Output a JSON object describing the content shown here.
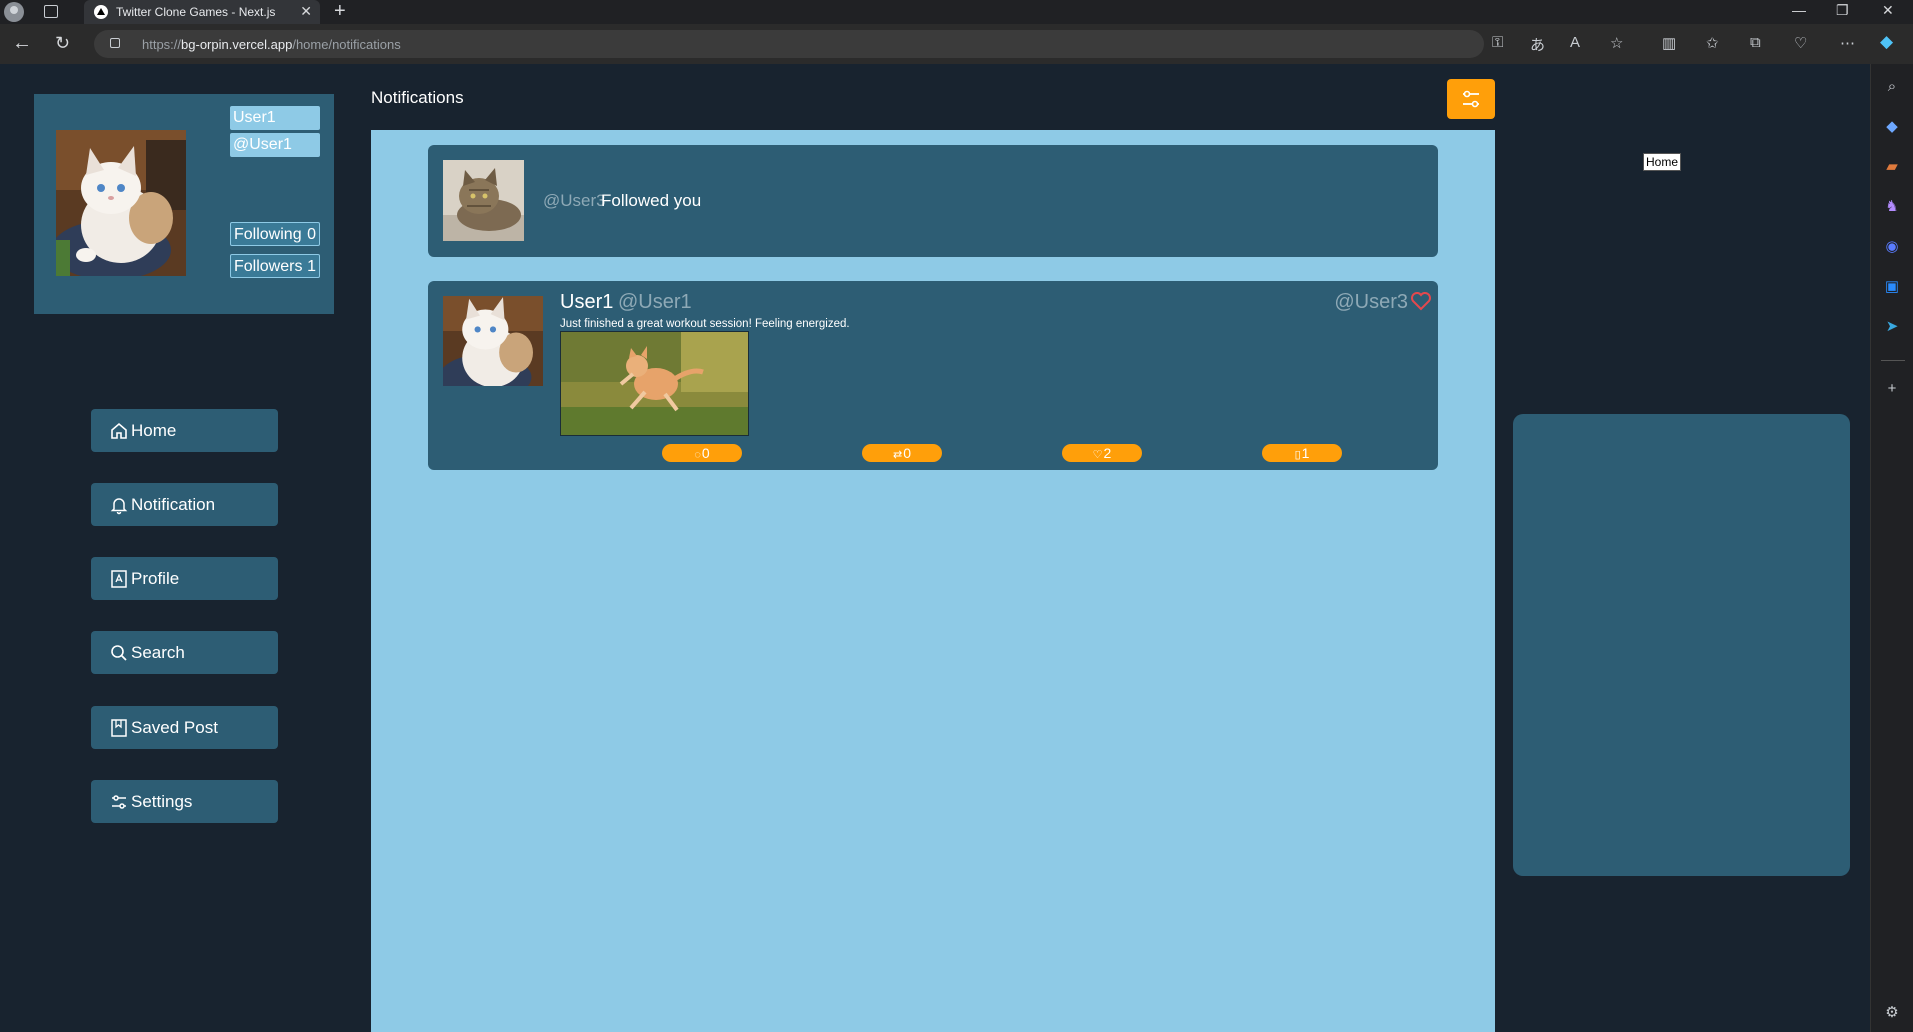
{
  "browser": {
    "tab_title": "Twitter Clone Games - Next.js",
    "tab_close": "✕",
    "new_tab": "+",
    "url_scheme": "https://",
    "url_host": "bg-orpin.vercel.app",
    "url_path": "/home/notifications",
    "window_controls": [
      "—",
      "❐",
      "✕"
    ]
  },
  "profile": {
    "display_name": "User1",
    "handle": "@User1",
    "following_label": "Following",
    "following_count": "0",
    "followers_label": "Followers",
    "followers_count": "1"
  },
  "nav": {
    "home": "Home",
    "notification": "Notification",
    "profile": "Profile",
    "search": "Search",
    "saved_post": "Saved Post",
    "settings": "Settings"
  },
  "page_title": "Notifications",
  "notifications": [
    {
      "type": "follow",
      "handle": "@User3",
      "text": "Followed you"
    },
    {
      "type": "like",
      "author_name": "User1",
      "author_handle": "@User1",
      "liked_by": "@User3",
      "text": "Just finished a great workout session! Feeling energized.",
      "stats": {
        "comments": "0",
        "retweets": "0",
        "likes": "2",
        "bookmarks": "1"
      }
    }
  ],
  "tooltip": "Home",
  "colors": {
    "background": "#18232f",
    "panel": "#8ecae6",
    "card": "#2d5d74",
    "accent": "#ff9f0a",
    "heart": "#e5484d"
  }
}
